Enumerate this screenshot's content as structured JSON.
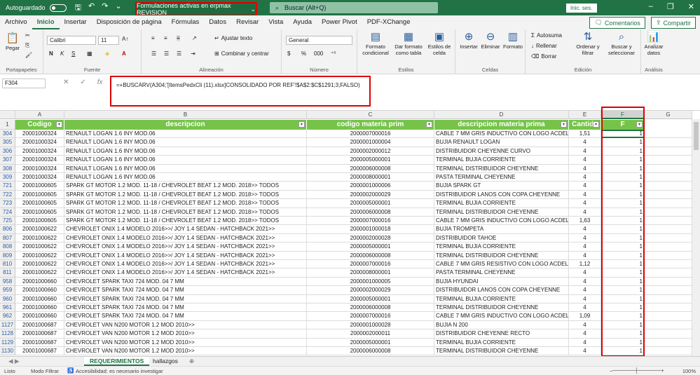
{
  "titlebar": {
    "autosave": "Autoguardado",
    "filename": "Formulaciones activas en erpmax REVISION",
    "search_placeholder": "Buscar (Alt+Q)",
    "signin": "Inic. ses."
  },
  "menu": [
    "Archivo",
    "Inicio",
    "Insertar",
    "Disposición de página",
    "Fórmulas",
    "Datos",
    "Revisar",
    "Vista",
    "Ayuda",
    "Power Pivot",
    "PDF-XChange"
  ],
  "menu_active": "Inicio",
  "comments_btn": "Comentarios",
  "share_btn": "Compartir",
  "ribbon": {
    "paste": "Pegar",
    "clipboard": "Portapapeles",
    "font_name": "Calibri",
    "font_size": "11",
    "bold": "N",
    "italic": "K",
    "underline": "S",
    "font_group": "Fuente",
    "wrap": "Ajustar texto",
    "merge": "Combinar y centrar",
    "align_group": "Alineación",
    "number_format": "General",
    "number_group": "Número",
    "cond_format": "Formato condicional",
    "format_table": "Dar formato como tabla",
    "cell_styles": "Estilos de celda",
    "styles_group": "Estilos",
    "insert": "Insertar",
    "delete": "Eliminar",
    "format": "Formato",
    "cells_group": "Celdas",
    "autosum": "Autosuma",
    "fill": "Rellenar",
    "clear": "Borrar",
    "sort": "Ordenar y filtrar",
    "find": "Buscar y seleccionar",
    "edit_group": "Edición",
    "analyze": "Analizar datos",
    "analysis_group": "Análisis"
  },
  "formula": {
    "cell_ref": "F304",
    "text": "=+BUSCARV(A304;'[ItemsPedxCli (11).xlsx]CONSOLIDADO POR REF'!$A$2:$C$1291;3;FALSO)"
  },
  "columns": [
    {
      "letter": "A"
    },
    {
      "letter": "B"
    },
    {
      "letter": "C"
    },
    {
      "letter": "D"
    },
    {
      "letter": "E"
    },
    {
      "letter": "F"
    },
    {
      "letter": "G"
    }
  ],
  "header_row": {
    "num": "1",
    "cells": [
      "Codigo",
      "descripcion",
      "codigo materia prim",
      "descripcion materia prima",
      "Cantida",
      "F",
      ""
    ]
  },
  "rows": [
    {
      "n": "304",
      "a": "20001000324",
      "b": "RENAULT LOGAN 1.6 INY MOD.06",
      "c": "2000007000016",
      "d": "CABLE 7 MM GRIS INDUCTIVO CON LOGO ACDELCO",
      "e": "1,51",
      "f": "1"
    },
    {
      "n": "305",
      "a": "20001000324",
      "b": "RENAULT LOGAN 1.6 INY MOD.06",
      "c": "2000001000004",
      "d": "BUJIA RENAULT LOGAN",
      "e": "4",
      "f": "1"
    },
    {
      "n": "306",
      "a": "20001000324",
      "b": "RENAULT LOGAN 1.6 INY MOD.06",
      "c": "2000002000012",
      "d": "DISTRIBUIDOR CHEYENNE CURVO",
      "e": "4",
      "f": "1"
    },
    {
      "n": "307",
      "a": "20001000324",
      "b": "RENAULT LOGAN 1.6 INY MOD.06",
      "c": "2000005000001",
      "d": "TERMINAL BUJIA CORRIENTE",
      "e": "4",
      "f": "1"
    },
    {
      "n": "308",
      "a": "20001000324",
      "b": "RENAULT LOGAN 1.6 INY MOD.06",
      "c": "2000006000008",
      "d": "TERMINAL DISTRIBUIDOR CHEYENNE",
      "e": "4",
      "f": "1"
    },
    {
      "n": "309",
      "a": "20001000324",
      "b": "RENAULT LOGAN 1.6 INY MOD.06",
      "c": "2000008000001",
      "d": "PASTA TERMINAL CHEYENNE",
      "e": "4",
      "f": "1"
    },
    {
      "n": "721",
      "a": "20001000605",
      "b": "SPARK GT MOTOR 1.2 MOD. 11-18 / CHEVROLET BEAT 1.2 MOD. 2018>> TODOS",
      "c": "2000001000006",
      "d": "BUJIA SPARK GT",
      "e": "4",
      "f": "1"
    },
    {
      "n": "722",
      "a": "20001000605",
      "b": "SPARK GT MOTOR 1.2 MOD. 11-18 / CHEVROLET BEAT 1.2 MOD. 2018>> TODOS",
      "c": "2000002000029",
      "d": "DISTRIBUIDOR LANOS CON COPA CHEYENNE",
      "e": "4",
      "f": "1"
    },
    {
      "n": "723",
      "a": "20001000605",
      "b": "SPARK GT MOTOR 1.2 MOD. 11-18 / CHEVROLET BEAT 1.2 MOD. 2018>> TODOS",
      "c": "2000005000001",
      "d": "TERMINAL BUJIA CORRIENTE",
      "e": "4",
      "f": "1"
    },
    {
      "n": "724",
      "a": "20001000605",
      "b": "SPARK GT MOTOR 1.2 MOD. 11-18 / CHEVROLET BEAT 1.2 MOD. 2018>> TODOS",
      "c": "2000006000008",
      "d": "TERMINAL DISTRIBUIDOR CHEYENNE",
      "e": "4",
      "f": "1"
    },
    {
      "n": "725",
      "a": "20001000605",
      "b": "SPARK GT MOTOR 1.2 MOD. 11-18 / CHEVROLET BEAT 1.2 MOD. 2018>> TODOS",
      "c": "2000007000016",
      "d": "CABLE 7 MM GRIS INDUCTIVO CON LOGO ACDELCO",
      "e": "1,63",
      "f": "1"
    },
    {
      "n": "806",
      "a": "20001000622",
      "b": "CHEVROLET ONIX 1.4 MODELO 2016>>/ JOY 1.4 SEDAN - HATCHBACK 2021>>",
      "c": "2000001000018",
      "d": "BUJIA TROMPETA",
      "e": "4",
      "f": "1"
    },
    {
      "n": "807",
      "a": "20001000622",
      "b": "CHEVROLET ONIX 1.4 MODELO 2016>>/ JOY 1.4 SEDAN - HATCHBACK 2021>>",
      "c": "2000002000028",
      "d": "DISTRIBUIDOR TAHOE",
      "e": "4",
      "f": "1"
    },
    {
      "n": "808",
      "a": "20001000622",
      "b": "CHEVROLET ONIX 1.4 MODELO 2016>>/ JOY 1.4 SEDAN - HATCHBACK 2021>>",
      "c": "2000005000001",
      "d": "TERMINAL BUJIA CORRIENTE",
      "e": "4",
      "f": "1"
    },
    {
      "n": "809",
      "a": "20001000622",
      "b": "CHEVROLET ONIX 1.4 MODELO 2016>>/ JOY 1.4 SEDAN - HATCHBACK 2021>>",
      "c": "2000006000008",
      "d": "TERMINAL DISTRIBUIDOR CHEYENNE",
      "e": "4",
      "f": "1"
    },
    {
      "n": "810",
      "a": "20001000622",
      "b": "CHEVROLET ONIX 1.4 MODELO 2016>>/ JOY 1.4 SEDAN - HATCHBACK 2021>>",
      "c": "2000007000016",
      "d": "CABLE 7 MM GRIS RESISTIVO CON LOGO ACDELCO",
      "e": "1,12",
      "f": "1"
    },
    {
      "n": "811",
      "a": "20001000622",
      "b": "CHEVROLET ONIX 1.4 MODELO 2016>>/ JOY 1.4 SEDAN - HATCHBACK 2021>>",
      "c": "2000008000001",
      "d": "PASTA TERMINAL CHEYENNE",
      "e": "4",
      "f": "1"
    },
    {
      "n": "958",
      "a": "20001000660",
      "b": "CHEVROLET SPARK TAXI 724 MOD. 04 7 MM",
      "c": "2000001000005",
      "d": "BUJIA HYUNDAI",
      "e": "4",
      "f": "1"
    },
    {
      "n": "959",
      "a": "20001000660",
      "b": "CHEVROLET SPARK TAXI 724 MOD. 04 7 MM",
      "c": "2000002000029",
      "d": "DISTRIBUIDOR LANOS CON COPA CHEYENNE",
      "e": "4",
      "f": "1"
    },
    {
      "n": "960",
      "a": "20001000660",
      "b": "CHEVROLET SPARK TAXI 724 MOD. 04 7 MM",
      "c": "2000005000001",
      "d": "TERMINAL BUJIA CORRIENTE",
      "e": "4",
      "f": "1"
    },
    {
      "n": "961",
      "a": "20001000660",
      "b": "CHEVROLET SPARK TAXI 724 MOD. 04 7 MM",
      "c": "2000006000008",
      "d": "TERMINAL DISTRIBUIDOR CHEYENNE",
      "e": "4",
      "f": "1"
    },
    {
      "n": "962",
      "a": "20001000660",
      "b": "CHEVROLET SPARK TAXI 724 MOD. 04 7 MM",
      "c": "2000007000016",
      "d": "CABLE 7 MM GRIS INDUCTIVO CON LOGO ACDELCO",
      "e": "1,09",
      "f": "1"
    },
    {
      "n": "1127",
      "a": "20001000687",
      "b": "CHEVROLET VAN N200 MOTOR 1.2 MOD 2010>>",
      "c": "2000001000028",
      "d": "BUJIA N 200",
      "e": "4",
      "f": "1"
    },
    {
      "n": "1128",
      "a": "20001000687",
      "b": "CHEVROLET VAN N200 MOTOR 1.2 MOD 2010>>",
      "c": "2000002000011",
      "d": "DISTRIBUIDOR CHEYENNE RECTO",
      "e": "4",
      "f": "1"
    },
    {
      "n": "1129",
      "a": "20001000687",
      "b": "CHEVROLET VAN N200 MOTOR 1.2 MOD 2010>>",
      "c": "2000005000001",
      "d": "TERMINAL BUJIA CORRIENTE",
      "e": "4",
      "f": "1"
    },
    {
      "n": "1130",
      "a": "20001000687",
      "b": "CHEVROLET VAN N200 MOTOR 1.2 MOD 2010>>",
      "c": "2000006000008",
      "d": "TERMINAL DISTRIBUIDOR CHEYENNE",
      "e": "4",
      "f": "1"
    }
  ],
  "sheets": [
    "REQUERIMIENTOS",
    "hallazgos"
  ],
  "active_sheet": "REQUERIMIENTOS",
  "status": {
    "ready": "Listo",
    "filter_mode": "Modo Filtrar",
    "accessibility": "Accesibilidad: es necesario investigar",
    "zoom": "100%"
  }
}
